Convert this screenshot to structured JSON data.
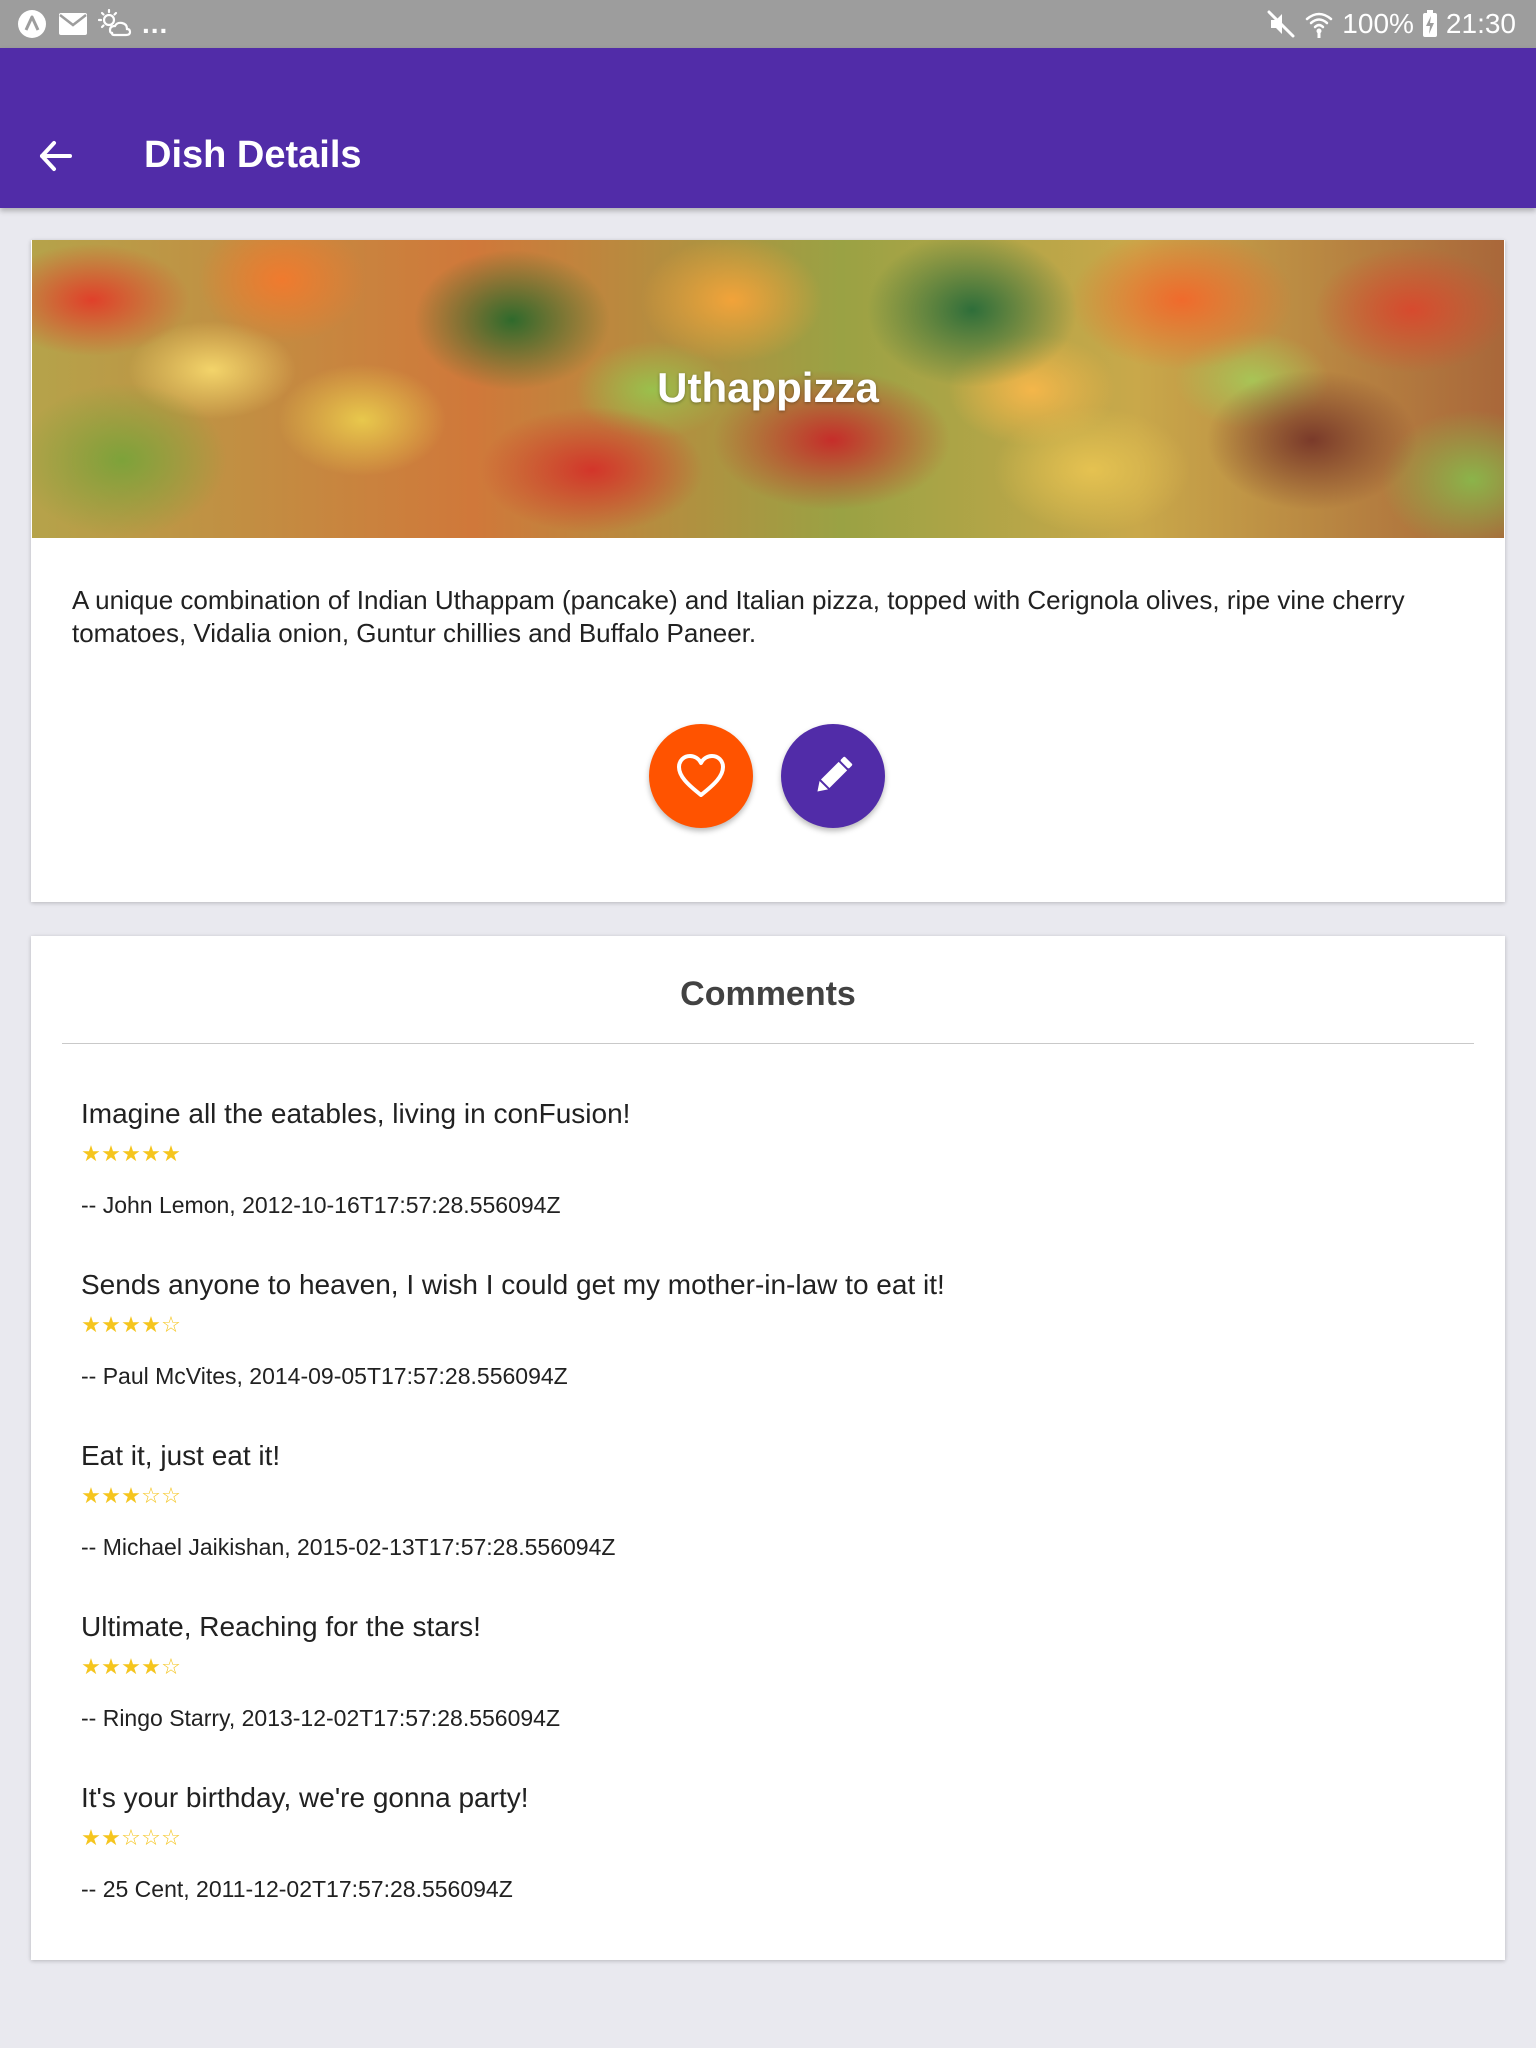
{
  "status_bar": {
    "battery_percent": "100%",
    "time": "21:30",
    "overflow_indicator": "...",
    "left_icons": [
      "app-notification-icon",
      "mail-icon",
      "weather-icon"
    ],
    "right_icons": [
      "mute-icon",
      "wifi-icon",
      "battery-charging-icon"
    ]
  },
  "app_bar": {
    "title": "Dish Details",
    "back_icon": "arrow-left-icon",
    "color": "#512ca8"
  },
  "dish": {
    "name": "Uthappizza",
    "description": "A unique combination of Indian Uthappam (pancake) and Italian pizza, topped with Cerignola olives, ripe vine cherry tomatoes, Vidalia onion, Guntur chillies and Buffalo Paneer.",
    "favorite_icon": "heart-outline-icon",
    "favorite_color": "#ff5300",
    "comment_icon": "pencil-icon",
    "comment_color": "#512ca8"
  },
  "comments": {
    "title": "Comments",
    "star_color": "#f5c51e",
    "max_rating": 5,
    "items": [
      {
        "text": "Imagine all the eatables, living in conFusion!",
        "rating": 5,
        "meta": "-- John Lemon, 2012-10-16T17:57:28.556094Z"
      },
      {
        "text": "Sends anyone to heaven, I wish I could get my mother-in-law to eat it!",
        "rating": 4,
        "meta": "-- Paul McVites, 2014-09-05T17:57:28.556094Z"
      },
      {
        "text": "Eat it, just eat it!",
        "rating": 3,
        "meta": "-- Michael Jaikishan, 2015-02-13T17:57:28.556094Z"
      },
      {
        "text": "Ultimate, Reaching for the stars!",
        "rating": 4,
        "meta": "-- Ringo Starry, 2013-12-02T17:57:28.556094Z"
      },
      {
        "text": "It's your birthday, we're gonna party!",
        "rating": 2,
        "meta": "-- 25 Cent, 2011-12-02T17:57:28.556094Z"
      }
    ]
  }
}
